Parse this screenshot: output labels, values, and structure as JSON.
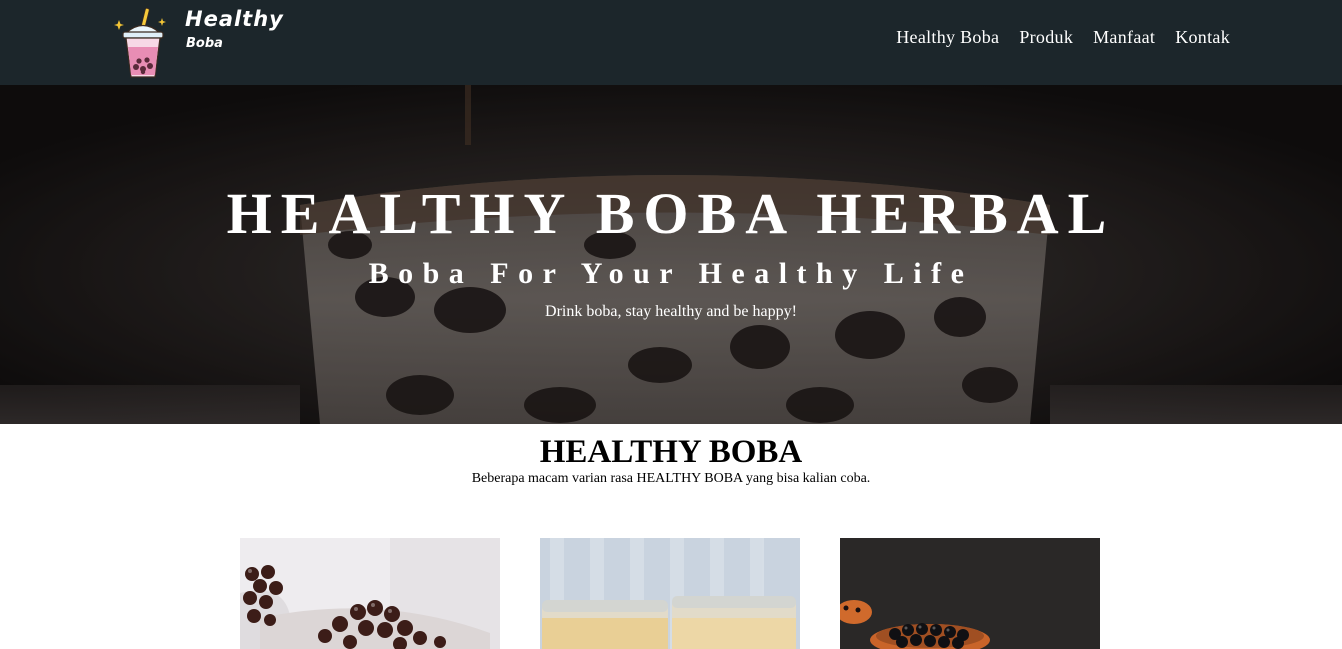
{
  "brand": {
    "name_line1": "Healthy",
    "name_line2": "Boba",
    "logo_icon": "bubble-tea-cup-icon"
  },
  "nav": {
    "items": [
      {
        "label": "Healthy Boba"
      },
      {
        "label": "Produk"
      },
      {
        "label": "Manfaat"
      },
      {
        "label": "Kontak"
      }
    ]
  },
  "hero": {
    "title": "HEALTHY BOBA HERBAL",
    "subtitle": "Boba For Your Healthy Life",
    "tagline": "Drink boba, stay healthy and be happy!"
  },
  "products": {
    "title": "HEALTHY BOBA",
    "description": "Beberapa macam varian rasa HEALTHY BOBA yang bisa kalian coba.",
    "cards": [
      {
        "image": "boba-pearls-cup-photo"
      },
      {
        "image": "milk-tea-jars-photo"
      },
      {
        "image": "boba-bowl-dark-photo"
      }
    ]
  },
  "colors": {
    "navbar_bg": "#1c262b",
    "hero_overlay": "#171313",
    "text_light": "#ffffff",
    "text_dark": "#000000"
  }
}
